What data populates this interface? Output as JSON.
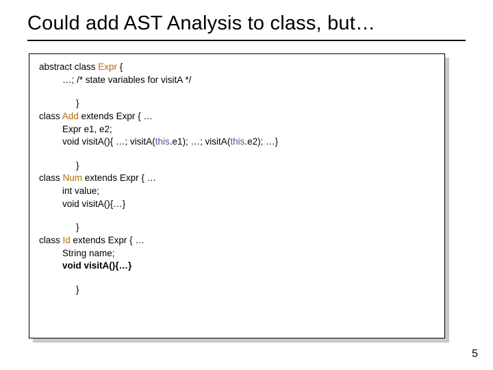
{
  "title": "Could add AST Analysis to class, but…",
  "page_number": "5",
  "code": {
    "l1a": "abstract class ",
    "l1b": "Expr",
    "l1c": " {",
    "l2": "…; /* state variables for visitA */",
    "l3": "}",
    "l4a": "class ",
    "l4b": "Add",
    "l4c": " extends Expr { …",
    "l5": "Expr e1, e2;",
    "l6a": "void visitA(){ …; visitA(",
    "l6b": "this",
    "l6c": ".e1); …; visitA(",
    "l6d": "this",
    "l6e": ".e2); …}",
    "l7": "}",
    "l8a": "class ",
    "l8b": "Num",
    "l8c": " extends Expr { …",
    "l9": "int value;",
    "l10": "void visitA(){…}",
    "l11": "}",
    "l12a": "class ",
    "l12b": "Id",
    "l12c": " extends Expr { …",
    "l13": "String name;",
    "l14": "void visitA(){…}",
    "l15": "}"
  }
}
